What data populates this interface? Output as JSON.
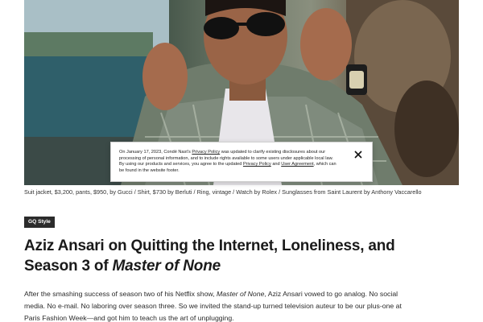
{
  "hero": {
    "caption": "Suit jacket, $3,200, pants, $950, by Gucci / Shirt, $730 by Berluti / Ring, vintage / Watch by Rolex / Sunglasses from Saint Laurent by Anthony Vaccarello"
  },
  "notice": {
    "part1": "On January 17, 2023, Condé Nast’s ",
    "privacy_link": "Privacy Policy",
    "part2": " was updated to clarify existing disclosures about our processing of personal information, and to include rights available to some users under applicable local law. By using our products and services, you agree to the updated ",
    "privacy_link_2": "Privacy Policy",
    "part3": " and ",
    "agreement_link": "User Agreement",
    "part4": ", which can be found in the website footer.",
    "close_icon": "close-icon"
  },
  "article": {
    "tag": "GQ Style",
    "headline_part1": "Aziz Ansari on Quitting the Internet, Loneliness, and Season 3 of ",
    "headline_italic": "Master of None",
    "dek_part1": "After the smashing success of season two of his Netflix show, ",
    "dek_italic": "Master of None",
    "dek_part2": ", Aziz Ansari vowed to go analog. No social media. No e-mail. No laboring over season three. So we invited the stand-up turned television auteur to be our plus-one at Paris Fashion Week—and got him to teach us the art of unplugging."
  },
  "colors": {
    "tag_bg": "#2b2b2b",
    "text": "#1a1a1a"
  }
}
